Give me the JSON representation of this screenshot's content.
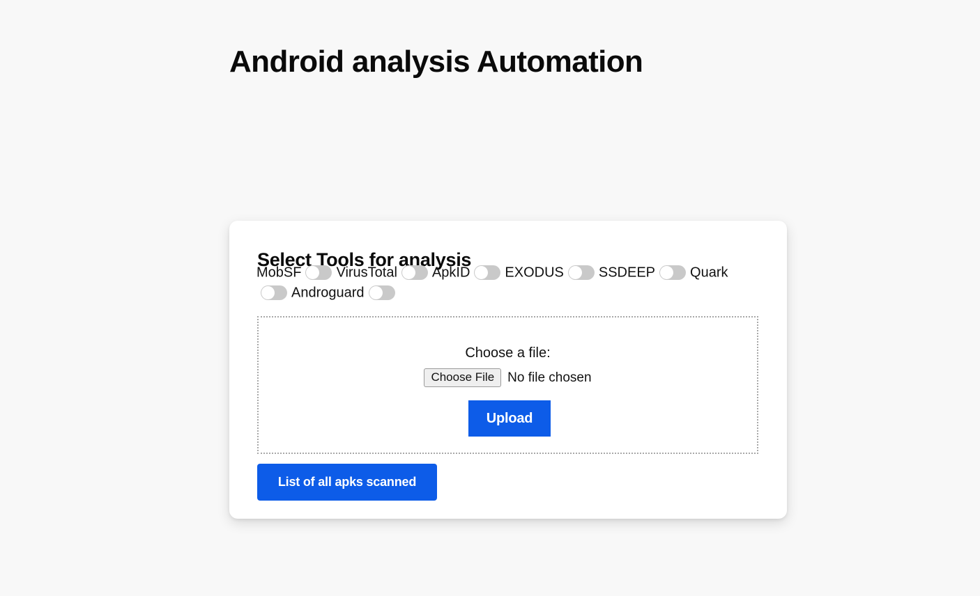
{
  "page": {
    "title": "Android analysis Automation",
    "background_color": "#f8f8f8"
  },
  "card": {
    "heading": "Select Tools for analysis",
    "background_color": "#ffffff"
  },
  "tools": [
    {
      "label": "MobSF",
      "enabled": false
    },
    {
      "label": "VirusTotal",
      "enabled": false
    },
    {
      "label": "ApkID",
      "enabled": false
    },
    {
      "label": "EXODUS",
      "enabled": false
    },
    {
      "label": "SSDEEP",
      "enabled": false
    },
    {
      "label": "Quark",
      "enabled": false
    },
    {
      "label": "Androguard",
      "enabled": false
    }
  ],
  "upload": {
    "prompt": "Choose a file:",
    "choose_button_label": "Choose File",
    "file_status": "No file chosen",
    "submit_label": "Upload"
  },
  "footer": {
    "list_button_label": "List of all apks scanned"
  },
  "colors": {
    "accent": "#0d5ce8",
    "toggle_off": "#c9c9c9",
    "toggle_knob": "#ffffff",
    "dropzone_border": "#a8a8a8"
  }
}
